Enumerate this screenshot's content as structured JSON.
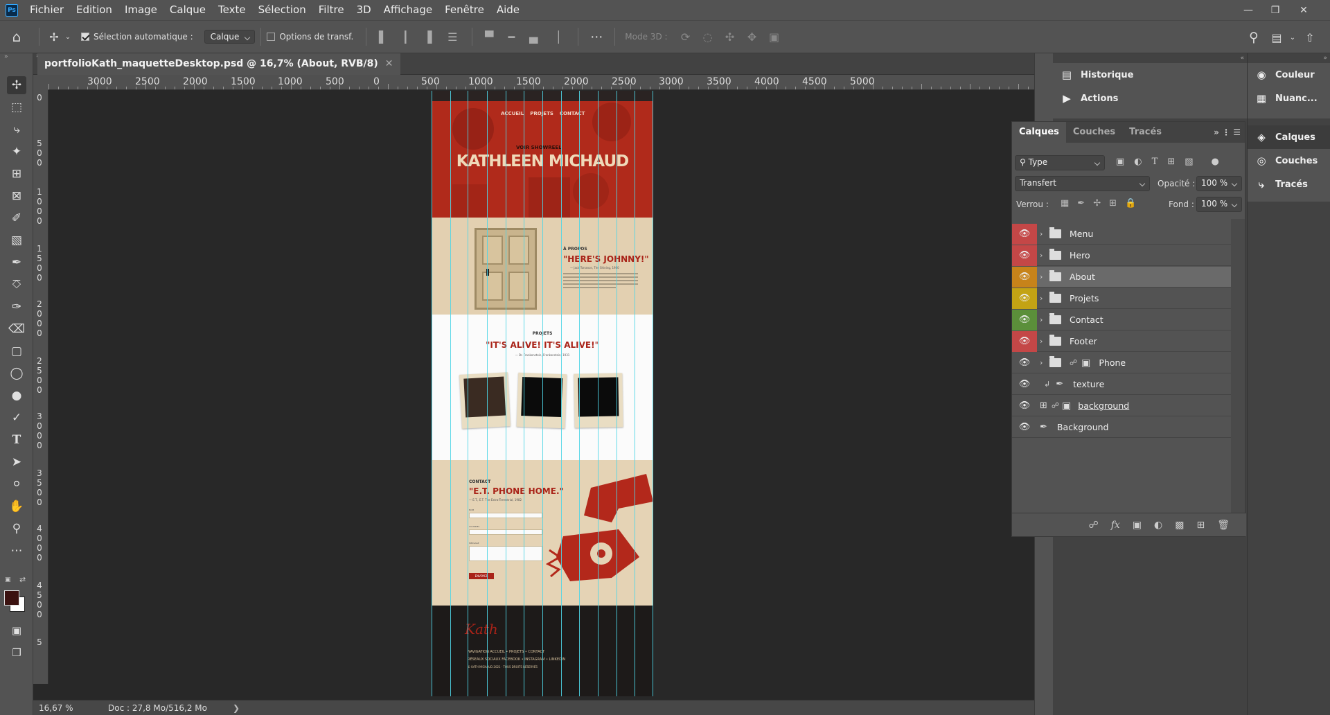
{
  "app": {
    "logo": "Ps"
  },
  "menu": [
    "Fichier",
    "Edition",
    "Image",
    "Calque",
    "Texte",
    "Sélection",
    "Filtre",
    "3D",
    "Affichage",
    "Fenêtre",
    "Aide"
  ],
  "options": {
    "auto_select_label": "Sélection automatique :",
    "auto_select_value": "Calque",
    "transform_label": "Options de transf.",
    "mode3d_label": "Mode 3D :"
  },
  "document": {
    "tab_title": "portfolioKath_maquetteDesktop.psd @ 16,7% (About, RVB/8)",
    "zoom": "16,67 %",
    "doc_size": "Doc : 27,8 Mo/516,2 Mo"
  },
  "rulers": {
    "h": [
      "0",
      "3000",
      "2500",
      "2000",
      "1500",
      "1000",
      "500",
      "0",
      "500",
      "1000",
      "1500",
      "2000",
      "2500",
      "3000",
      "3500",
      "4000",
      "4500",
      "5000"
    ],
    "v": [
      "0",
      "5 0 0",
      "1 0 0 0",
      "1 5 0 0",
      "2 0 0 0",
      "2 5 0 0",
      "3 0 0 0",
      "3 5 0 0",
      "4 0 0 0",
      "4 5 0 0",
      "5"
    ]
  },
  "artboard": {
    "nav": [
      "ACCUEIL",
      "PROJETS",
      "CONTACT"
    ],
    "showreel": "VOIR SHOWREEL",
    "name": "KATHLEEN MICHAUD",
    "about_label": "À PROPOS",
    "about_quote": "\"HERE'S JOHNNY!\"",
    "about_sub": "— Jack Torrance, The Shining, 1980",
    "projets_label": "PROJETS",
    "projets_quote": "\"IT'S ALIVE! IT'S ALIVE!\"",
    "projets_sub": "— Dr. Frankenstein, Frankenstein, 1931",
    "contact_label": "CONTACT",
    "contact_quote": "\"E.T. PHONE HOME.\"",
    "contact_sub": "— E.T., E.T. The Extra-Terrestrial, 1982",
    "field_labels": [
      "NOM",
      "COURRIEL",
      "MESSAGE"
    ],
    "send": "ENVOYER",
    "signature": "Kath",
    "footer_l1": "NAVIGATION  ACCUEIL  •  PROJETS  •  CONTACT",
    "footer_l2": "RÉSEAUX SOCIAUX  FACEBOOK  •  INSTAGRAM  •  LINKEDIN",
    "footer_l3": "© KATH MICHAUD  2021  ·  TOUS DROITS RÉSERVÉS"
  },
  "panels": {
    "historique": "Historique",
    "actions": "Actions",
    "couleur": "Couleur",
    "nuancier": "Nuanc...",
    "calques_side": "Calques",
    "couches_side": "Couches",
    "traces_side": "Tracés"
  },
  "layers_panel": {
    "tabs": [
      "Calques",
      "Couches",
      "Tracés"
    ],
    "filter": "Type",
    "blend": "Transfert",
    "opacity_label": "Opacité :",
    "opacity": "100 %",
    "lock_label": "Verrou :",
    "fill_label": "Fond :",
    "fill": "100 %",
    "layers": [
      {
        "name": "Menu",
        "color": "#c44747",
        "type": "folder"
      },
      {
        "name": "Hero",
        "color": "#c44747",
        "type": "folder"
      },
      {
        "name": "About",
        "color": "#c7831a",
        "type": "folder"
      },
      {
        "name": "Projets",
        "color": "#c3a314",
        "type": "folder"
      },
      {
        "name": "Contact",
        "color": "#5b8f3a",
        "type": "folder"
      },
      {
        "name": "Footer",
        "color": "#c44747",
        "type": "folder"
      },
      {
        "name": "Phone",
        "color": "",
        "type": "folder-mask"
      },
      {
        "name": "texture",
        "color": "",
        "type": "brush-clip"
      },
      {
        "name": "background",
        "color": "",
        "type": "smart"
      },
      {
        "name": "Background",
        "color": "",
        "type": "brush"
      }
    ]
  },
  "colors": {
    "foreground": "#3b1210",
    "background": "#ffffff",
    "guide": "#4fd5e6",
    "accent_red": "#a92318"
  }
}
